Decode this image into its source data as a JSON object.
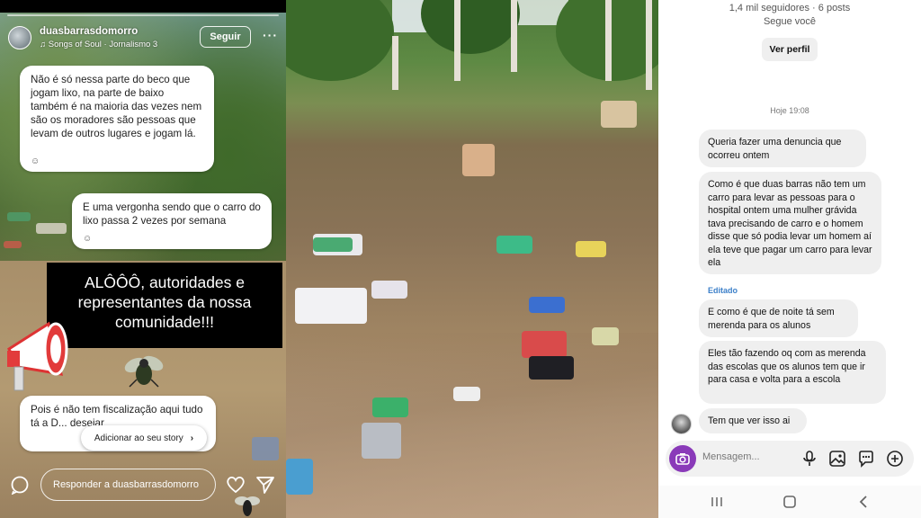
{
  "story": {
    "username": "duasbarrasdomorro",
    "music": "Songs of Soul · Jornalismo 3",
    "follow_label": "Seguir",
    "more_label": "···",
    "bubble1": "Não é só nessa parte do beco que jogam lixo, na parte de baixo também é na maioria das vezes nem são os moradores são pessoas que levam de outros lugares e jogam lá.",
    "bubble2": "E uma vergonha sendo que o carro do lixo passa 2 vezes por semana",
    "headline": "ALÔÔÔ, autoridades e representantes da nossa comunidade!!!",
    "bubble4": "Pois é não tem fiscalização aqui tudo tá a D... desejar",
    "add_story_label": "Adicionar ao seu story",
    "reply_placeholder": "Responder a duasbarrasdomorro"
  },
  "chat": {
    "followers": "1,4 mil seguidores · 6 posts",
    "follows_you": "Segue você",
    "view_profile": "Ver perfil",
    "time": "Hoje 19:08",
    "messages": [
      "Queria fazer uma denuncia que ocorreu ontem",
      "Como é que duas barras não tem um carro para levar as pessoas para o hospital ontem uma mulher grávida tava precisando de carro e o homem disse que só podia levar um homem aí ela teve que pagar um carro para levar ela",
      "E como é que de noite tá sem merenda para os alunos",
      "Eles tão fazendo oq com as merenda das escolas que os alunos tem que ir para casa e volta para a escola",
      "Tem que ver isso ai"
    ],
    "edited_label": "Editado",
    "composer_placeholder": "Mensagem..."
  },
  "colors": {
    "accent_purple": "#8a3ab9",
    "edited_blue": "#3d80c9",
    "bubble_gray": "#efefef"
  },
  "icons": {
    "story": [
      "music-icon",
      "more-icon",
      "emoji-icon",
      "megaphone-icon",
      "fly-icon",
      "chevron-right-icon",
      "reply-icon",
      "heart-icon",
      "send-icon"
    ],
    "chat": [
      "camera-icon",
      "microphone-icon",
      "image-icon",
      "sticker-icon",
      "plus-icon",
      "nav-recents-icon",
      "nav-home-icon",
      "nav-back-icon"
    ]
  }
}
